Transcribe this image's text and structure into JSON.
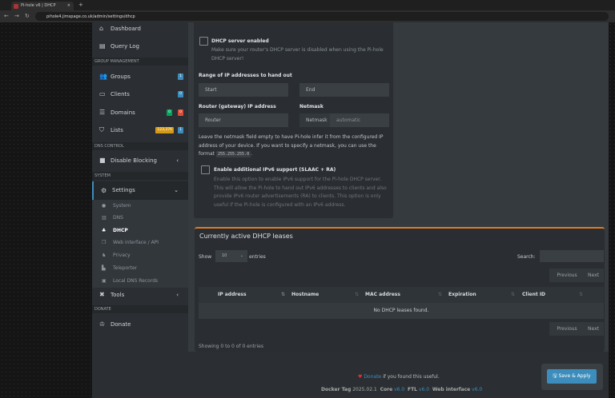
{
  "browser": {
    "tab_title": "Pi-hole v6 | DHCP",
    "url": "pihole4.jimspage.co.uk/admin/settings/dhcp"
  },
  "sidebar": {
    "items": [
      {
        "label": "Dashboard",
        "icon": "home-icon"
      },
      {
        "label": "Query Log",
        "icon": "file-icon"
      }
    ],
    "group_header": "GROUP MANAGEMENT",
    "groups": {
      "label": "Groups",
      "badge": "1"
    },
    "clients": {
      "label": "Clients",
      "badge": "0"
    },
    "domains": {
      "label": "Domains",
      "badge_green": "0",
      "badge_red": "0"
    },
    "lists": {
      "label": "Lists",
      "badge_yellow": "123,376",
      "badge_blue": "1"
    },
    "dns_header": "DNS CONTROL",
    "disable_blocking": "Disable Blocking",
    "system_header": "SYSTEM",
    "settings": "Settings",
    "settings_sub": [
      "System",
      "DNS",
      "DHCP",
      "Web interface / API",
      "Privacy",
      "Teleporter",
      "Local DNS Records"
    ],
    "tools": "Tools",
    "donate_header": "DONATE",
    "donate": "Donate"
  },
  "dhcp": {
    "enabled_label": "DHCP server enabled",
    "enabled_help": "Make sure your router's DHCP server is disabled when using the Pi-hole DHCP server!",
    "range_label": "Range of IP addresses to hand out",
    "start_placeholder": "Start",
    "end_placeholder": "End",
    "router_label": "Router (gateway) IP address",
    "router_placeholder": "Router",
    "netmask_label": "Netmask",
    "netmask_addon": "Netmask",
    "netmask_placeholder": "automatic",
    "netmask_help": "Leave the netmask field empty to have Pi-hole infer it from the configured IP address of your device. If you want to specify a netmask, you can use the format",
    "netmask_format": "255.255.255.0",
    "ipv6_label": "Enable additional IPv6 support (SLAAC + RA)",
    "ipv6_help": "Enable this option to enable IPv6 support for the Pi-hole DHCP server. This will allow the Pi-hole to hand out IPv6 addresses to clients and also provide IPv6 router advertisements (RA) to clients. This option is only useful if the Pi-hole is configured with an IPv6 address."
  },
  "leases": {
    "title": "Currently active DHCP leases",
    "show": "Show",
    "entries_value": "10",
    "entries": "entries",
    "search": "Search:",
    "previous": "Previous",
    "next": "Next",
    "columns": [
      "IP address",
      "Hostname",
      "MAC address",
      "Expiration",
      "Client ID"
    ],
    "empty": "No DHCP leases found.",
    "info": "Showing 0 to 0 of 0 entries",
    "accent": "#e07b24"
  },
  "footer": {
    "donate_link": "Donate",
    "donate_text": "if you found this useful.",
    "docker_label": "Docker Tag",
    "docker": "2025.02.1",
    "core_label": "Core",
    "core": "v6.0",
    "ftl_label": "FTL",
    "ftl": "v6.0",
    "web_label": "Web interface",
    "web": "v6.0"
  },
  "save_button": "Save & Apply"
}
